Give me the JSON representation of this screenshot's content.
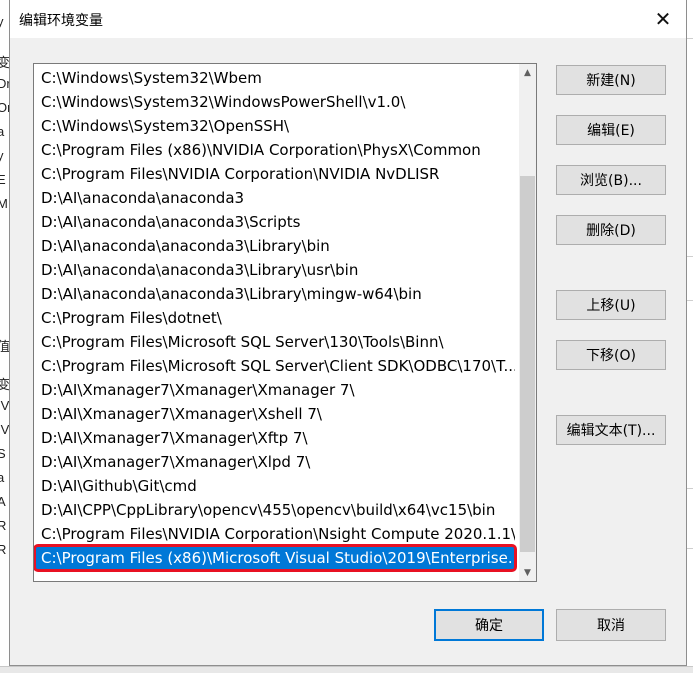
{
  "dialog": {
    "title": "编辑环境变量"
  },
  "close_glyph": "✕",
  "background_fragments": [
    "y",
    "变",
    "Dr",
    "Or",
    "a",
    "y",
    "E",
    "M",
    "值",
    "变",
    "IV",
    "IV",
    "S",
    "a",
    "A",
    "R",
    "R"
  ],
  "path_list": [
    "C:\\Windows\\System32\\Wbem",
    "C:\\Windows\\System32\\WindowsPowerShell\\v1.0\\",
    "C:\\Windows\\System32\\OpenSSH\\",
    "C:\\Program Files (x86)\\NVIDIA Corporation\\PhysX\\Common",
    "C:\\Program Files\\NVIDIA Corporation\\NVIDIA NvDLISR",
    "D:\\AI\\anaconda\\anaconda3",
    "D:\\AI\\anaconda\\anaconda3\\Scripts",
    "D:\\AI\\anaconda\\anaconda3\\Library\\bin",
    "D:\\AI\\anaconda\\anaconda3\\Library\\usr\\bin",
    "D:\\AI\\anaconda\\anaconda3\\Library\\mingw-w64\\bin",
    "C:\\Program Files\\dotnet\\",
    "C:\\Program Files\\Microsoft SQL Server\\130\\Tools\\Binn\\",
    "C:\\Program Files\\Microsoft SQL Server\\Client SDK\\ODBC\\170\\T...",
    "D:\\AI\\Xmanager7\\Xmanager\\Xmanager 7\\",
    "D:\\AI\\Xmanager7\\Xmanager\\Xshell 7\\",
    "D:\\AI\\Xmanager7\\Xmanager\\Xftp 7\\",
    "D:\\AI\\Xmanager7\\Xmanager\\Xlpd 7\\",
    "D:\\AI\\Github\\Git\\cmd",
    "D:\\AI\\CPP\\CppLibrary\\opencv\\455\\opencv\\build\\x64\\vc15\\bin",
    "C:\\Program Files\\NVIDIA Corporation\\Nsight Compute 2020.1.1\\",
    "C:\\Program Files (x86)\\Microsoft Visual Studio\\2019\\Enterprise..."
  ],
  "selected_index": 20,
  "buttons": {
    "new": "新建(N)",
    "edit": "编辑(E)",
    "browse": "浏览(B)...",
    "delete": "删除(D)",
    "move_up": "上移(U)",
    "move_down": "下移(O)",
    "edit_text": "编辑文本(T)...",
    "ok": "确定",
    "cancel": "取消"
  },
  "colors": {
    "selection": "#0078d7",
    "highlight_outline": "#e81123",
    "default_button_border": "#0078d7"
  }
}
